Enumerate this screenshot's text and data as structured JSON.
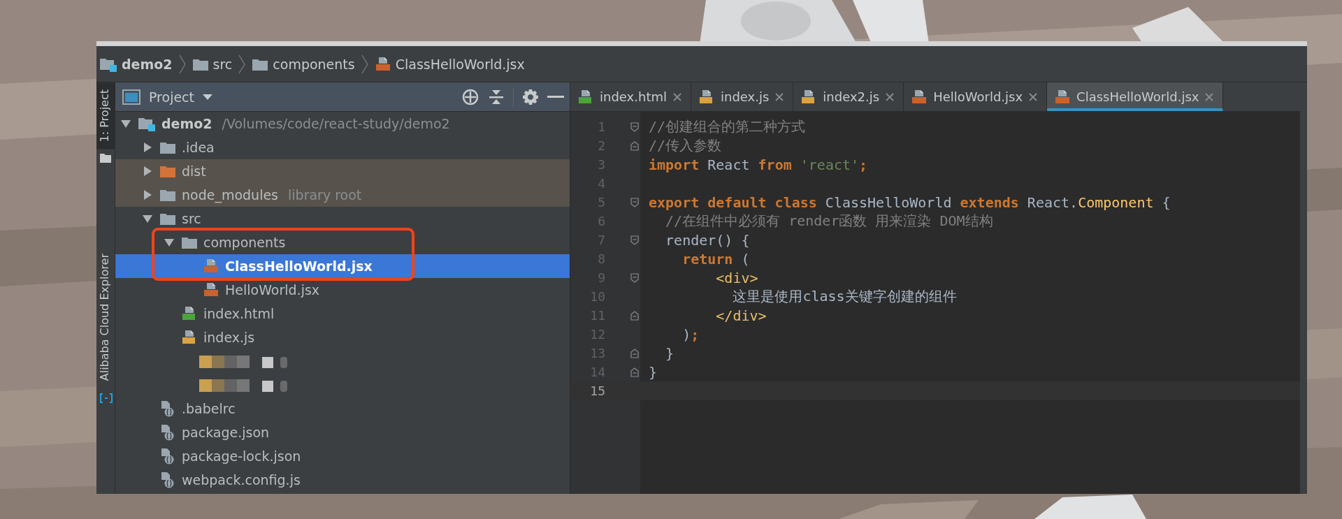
{
  "breadcrumb": [
    {
      "label": "demo2",
      "kind": "module"
    },
    {
      "label": "src",
      "kind": "folder"
    },
    {
      "label": "components",
      "kind": "folder"
    },
    {
      "label": "ClassHelloWorld.jsx",
      "kind": "jsx"
    }
  ],
  "tool_strip": [
    {
      "label": "1: Project",
      "selected": true
    },
    {
      "label": "Alibaba Cloud Explorer",
      "selected": false
    }
  ],
  "project_panel": {
    "title": "Project",
    "tree": [
      {
        "kind": "module",
        "label": "demo2",
        "hint": "/Volumes/code/react-study/demo2",
        "expanded": true,
        "selected": false,
        "tinted": false,
        "boxed": false,
        "children": [
          {
            "kind": "folder",
            "label": ".idea",
            "expanded": false,
            "selected": false,
            "tinted": false,
            "boxed": false
          },
          {
            "kind": "folder-excluded",
            "label": "dist",
            "expanded": false,
            "selected": false,
            "tinted": true,
            "boxed": false
          },
          {
            "kind": "folder",
            "label": "node_modules",
            "hint": "library root",
            "expanded": false,
            "selected": false,
            "tinted": true,
            "boxed": false
          },
          {
            "kind": "folder",
            "label": "src",
            "expanded": true,
            "selected": false,
            "tinted": false,
            "boxed": false,
            "children": [
              {
                "kind": "folder",
                "label": "components",
                "expanded": true,
                "selected": false,
                "tinted": false,
                "boxed": true,
                "children": [
                  {
                    "kind": "jsx",
                    "label": "ClassHelloWorld.jsx",
                    "selected": true,
                    "tinted": false,
                    "boxed": true
                  },
                  {
                    "kind": "jsx",
                    "label": "HelloWorld.jsx",
                    "selected": false,
                    "tinted": false,
                    "boxed": false
                  }
                ]
              },
              {
                "kind": "html",
                "label": "index.html",
                "selected": false,
                "tinted": false,
                "boxed": false
              },
              {
                "kind": "js",
                "label": "index.js",
                "selected": false,
                "tinted": false,
                "boxed": false
              },
              {
                "kind": "redacted"
              },
              {
                "kind": "redacted"
              }
            ]
          },
          {
            "kind": "config",
            "label": ".babelrc",
            "selected": false,
            "tinted": false,
            "boxed": false
          },
          {
            "kind": "config",
            "label": "package.json",
            "selected": false,
            "tinted": false,
            "boxed": false
          },
          {
            "kind": "config",
            "label": "package-lock.json",
            "selected": false,
            "tinted": false,
            "boxed": false
          },
          {
            "kind": "config",
            "label": "webpack.config.js",
            "selected": false,
            "tinted": false,
            "boxed": false
          }
        ]
      }
    ]
  },
  "editor": {
    "tabs": [
      {
        "label": "index.html",
        "kind": "html",
        "selected": false
      },
      {
        "label": "index.js",
        "kind": "js",
        "selected": false
      },
      {
        "label": "index2.js",
        "kind": "js",
        "selected": false
      },
      {
        "label": "HelloWorld.jsx",
        "kind": "jsx",
        "selected": false
      },
      {
        "label": "ClassHelloWorld.jsx",
        "kind": "jsx",
        "selected": true
      }
    ],
    "lines": [
      {
        "number": "1",
        "fold_open": true,
        "fold_close": false,
        "current": false,
        "tokens": [
          {
            "kind": "comment",
            "text": "//创建组合的第二种方式"
          }
        ]
      },
      {
        "number": "2",
        "fold_open": false,
        "fold_close": true,
        "current": false,
        "tokens": [
          {
            "kind": "comment",
            "text": "//传入参数"
          }
        ]
      },
      {
        "number": "3",
        "fold_open": false,
        "fold_close": false,
        "current": false,
        "tokens": [
          {
            "kind": "keyword",
            "text": "import"
          },
          {
            "kind": "plain",
            "text": " React "
          },
          {
            "kind": "keyword",
            "text": "from"
          },
          {
            "kind": "string",
            "text": " 'react'"
          },
          {
            "kind": "keyword",
            "text": ";"
          }
        ]
      },
      {
        "number": "4",
        "fold_open": false,
        "fold_close": false,
        "current": false
      },
      {
        "number": "5",
        "fold_open": true,
        "fold_close": false,
        "current": false,
        "tokens": [
          {
            "kind": "keyword",
            "text": "export default class"
          },
          {
            "kind": "plain",
            "text": " ClassHelloWorld "
          },
          {
            "kind": "keyword",
            "text": "extends"
          },
          {
            "kind": "plain",
            "text": " React."
          },
          {
            "kind": "class",
            "text": "Component"
          },
          {
            "kind": "plain",
            "text": " {"
          }
        ]
      },
      {
        "number": "6",
        "fold_open": false,
        "fold_close": false,
        "current": false,
        "tokens": [
          {
            "kind": "comment",
            "text": "  //在组件中必须有 render函数 用来渲染 DOM结构"
          }
        ]
      },
      {
        "number": "7",
        "fold_open": true,
        "fold_close": false,
        "current": false,
        "tokens": [
          {
            "kind": "plain",
            "text": "  render() {"
          }
        ]
      },
      {
        "number": "8",
        "fold_open": false,
        "fold_close": false,
        "current": false,
        "tokens": [
          {
            "kind": "keyword",
            "text": "    return"
          },
          {
            "kind": "plain",
            "text": " ("
          }
        ]
      },
      {
        "number": "9",
        "fold_open": true,
        "fold_close": false,
        "current": false,
        "tokens": [
          {
            "kind": "tag",
            "text": "        <div>"
          }
        ]
      },
      {
        "number": "10",
        "fold_open": false,
        "fold_close": false,
        "current": false,
        "tokens": [
          {
            "kind": "plain",
            "text": "          这里是使用class关键字创建的组件"
          }
        ]
      },
      {
        "number": "11",
        "fold_open": false,
        "fold_close": true,
        "current": false,
        "tokens": [
          {
            "kind": "tag",
            "text": "        </div>"
          }
        ]
      },
      {
        "number": "12",
        "fold_open": false,
        "fold_close": false,
        "current": false,
        "tokens": [
          {
            "kind": "plain",
            "text": "    )"
          },
          {
            "kind": "keyword",
            "text": ";"
          }
        ]
      },
      {
        "number": "13",
        "fold_open": false,
        "fold_close": true,
        "current": false,
        "tokens": [
          {
            "kind": "plain",
            "text": "  }"
          }
        ]
      },
      {
        "number": "14",
        "fold_open": false,
        "fold_close": true,
        "current": false,
        "tokens": [
          {
            "kind": "plain",
            "text": "}"
          }
        ]
      },
      {
        "number": "15",
        "fold_open": false,
        "fold_close": false,
        "current": true
      }
    ]
  }
}
